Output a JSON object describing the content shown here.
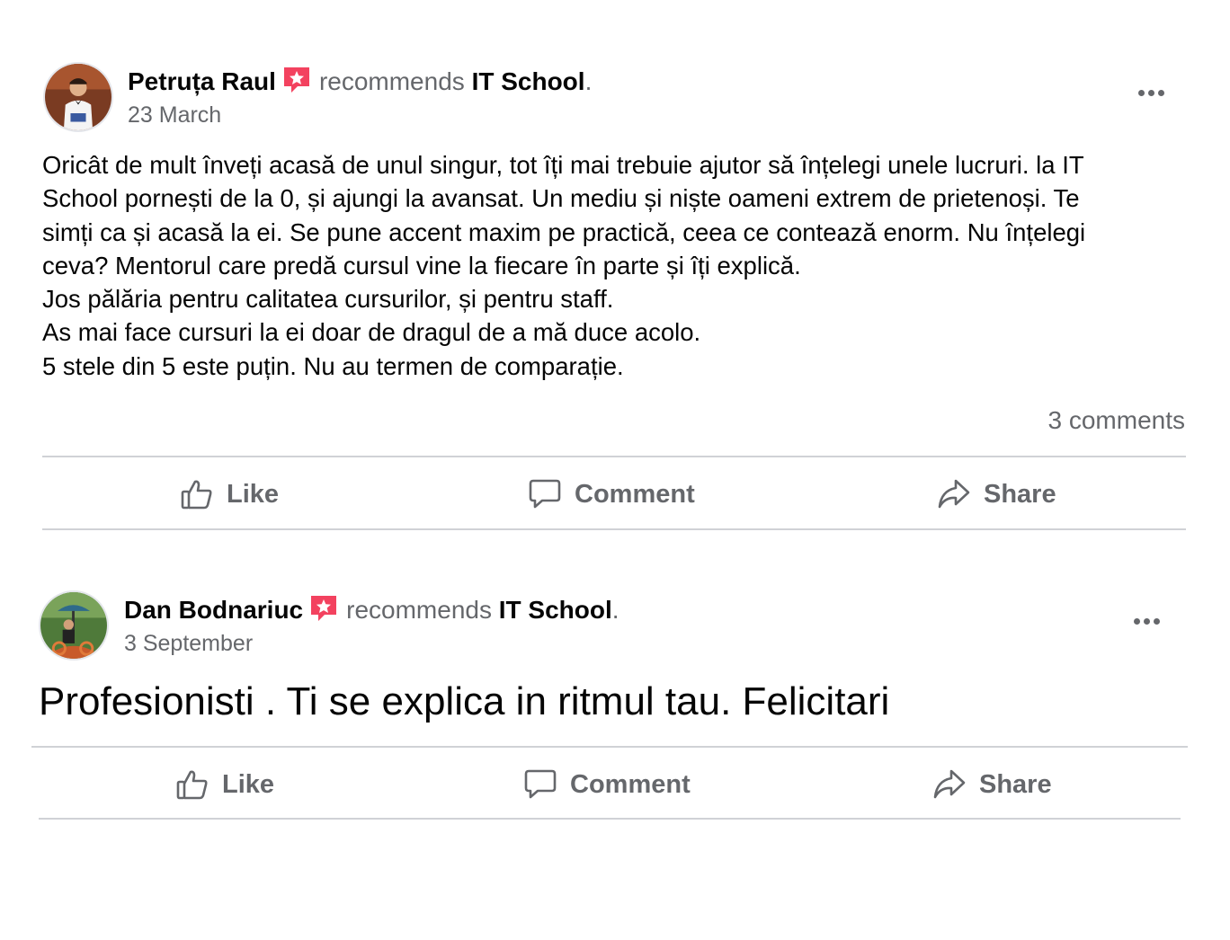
{
  "posts": [
    {
      "author": "Petruța Raul",
      "verb": "recommends",
      "page": "IT School",
      "period": ".",
      "date": "23 March",
      "body_lines": [
        "Oricât de mult înveți acasă de unul singur, tot îți mai trebuie ajutor să înțelegi unele lucruri. la IT",
        "School pornești de la 0, și ajungi la avansat. Un mediu și niște oameni extrem de prietenoși. Te",
        "simți ca și acasă la ei. Se pune accent maxim pe practică, ceea ce contează enorm. Nu înțelegi",
        "ceva? Mentorul care predă cursul vine la fiecare în parte și îți explică.",
        "Jos pălăria pentru calitatea cursurilor, și pentru staff.",
        "As mai face cursuri la ei doar de dragul de a mă duce acolo.",
        "5 stele din 5 este puțin. Nu au termen de comparație."
      ],
      "comments": "3 comments",
      "actions": {
        "like": "Like",
        "comment": "Comment",
        "share": "Share"
      }
    },
    {
      "author": "Dan Bodnariuc",
      "verb": "recommends",
      "page": "IT School",
      "period": ".",
      "date": "3 September",
      "body": "Profesionisti . Ti se explica in ritmul tau. Felicitari",
      "actions": {
        "like": "Like",
        "comment": "Comment",
        "share": "Share"
      }
    }
  ],
  "colors": {
    "text": "#050505",
    "muted": "#65676b",
    "badge": "#f3425f",
    "divider": "#d0d2d6"
  },
  "icons": [
    "recommend-badge-icon",
    "more-options-icon",
    "like-icon",
    "comment-icon",
    "share-icon"
  ]
}
